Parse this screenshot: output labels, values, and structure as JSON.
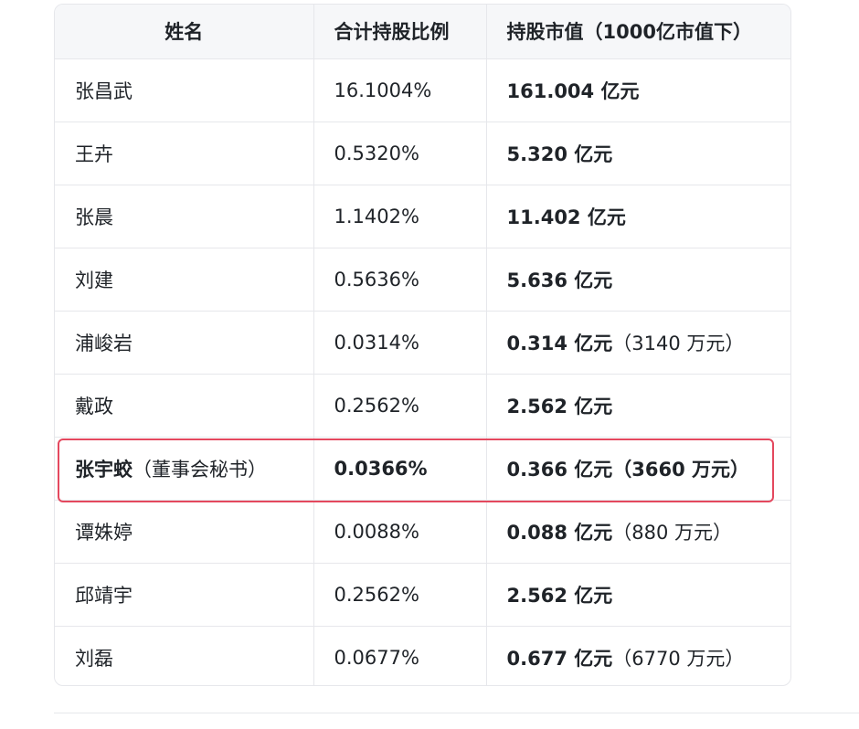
{
  "table": {
    "headers": [
      "姓名",
      "合计持股比例",
      "持股市值（1000亿市值下）"
    ],
    "rows": [
      {
        "name": "张昌武",
        "note": "",
        "ratio": "16.1004%",
        "value": "161.004 亿元",
        "extra": ""
      },
      {
        "name": "王卉",
        "note": "",
        "ratio": "0.5320%",
        "value": "5.320 亿元",
        "extra": ""
      },
      {
        "name": "张晨",
        "note": "",
        "ratio": "1.1402%",
        "value": "11.402 亿元",
        "extra": ""
      },
      {
        "name": "刘建",
        "note": "",
        "ratio": "0.5636%",
        "value": "5.636 亿元",
        "extra": ""
      },
      {
        "name": "浦峻岩",
        "note": "",
        "ratio": "0.0314%",
        "value": "0.314 亿元",
        "extra": "（3140 万元）"
      },
      {
        "name": "戴政",
        "note": "",
        "ratio": "0.2562%",
        "value": "2.562 亿元",
        "extra": ""
      },
      {
        "name": "张宇蛟",
        "note": "（董事会秘书）",
        "ratio": "0.0366%",
        "value": "0.366 亿元",
        "extra": "（3660 万元）"
      },
      {
        "name": "谭姝婷",
        "note": "",
        "ratio": "0.0088%",
        "value": "0.088 亿元",
        "extra": "（880 万元）"
      },
      {
        "name": "邱靖宇",
        "note": "",
        "ratio": "0.2562%",
        "value": "2.562 亿元",
        "extra": ""
      },
      {
        "name": "刘磊",
        "note": "",
        "ratio": "0.0677%",
        "value": "0.677 亿元",
        "extra": "（6770 万元）"
      }
    ]
  },
  "colors": {
    "highlight_border": "#e4485e",
    "header_bg": "#f6f7f9",
    "grid": "#e6e7eb"
  }
}
